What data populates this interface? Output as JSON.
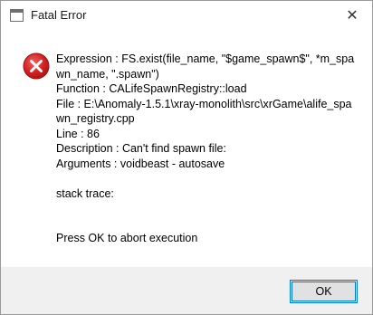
{
  "window": {
    "title": "Fatal Error",
    "close_glyph": "✕"
  },
  "icons": {
    "app": "window-icon",
    "error": "error-icon",
    "error_color": "#d42020"
  },
  "message": {
    "text": "Expression    : FS.exist(file_name, \"$game_spawn$\", *m_spawn_name, \".spawn\")\nFunction      : CALifeSpawnRegistry::load\nFile          : E:\\Anomaly-1.5.1\\xray-monolith\\src\\xrGame\\alife_spawn_registry.cpp\nLine          : 86\nDescription   : Can't find spawn file:\nArguments     : voidbeast - autosave\n\nstack trace:\n\n\nPress OK to abort execution"
  },
  "buttons": {
    "ok_label": "OK"
  }
}
